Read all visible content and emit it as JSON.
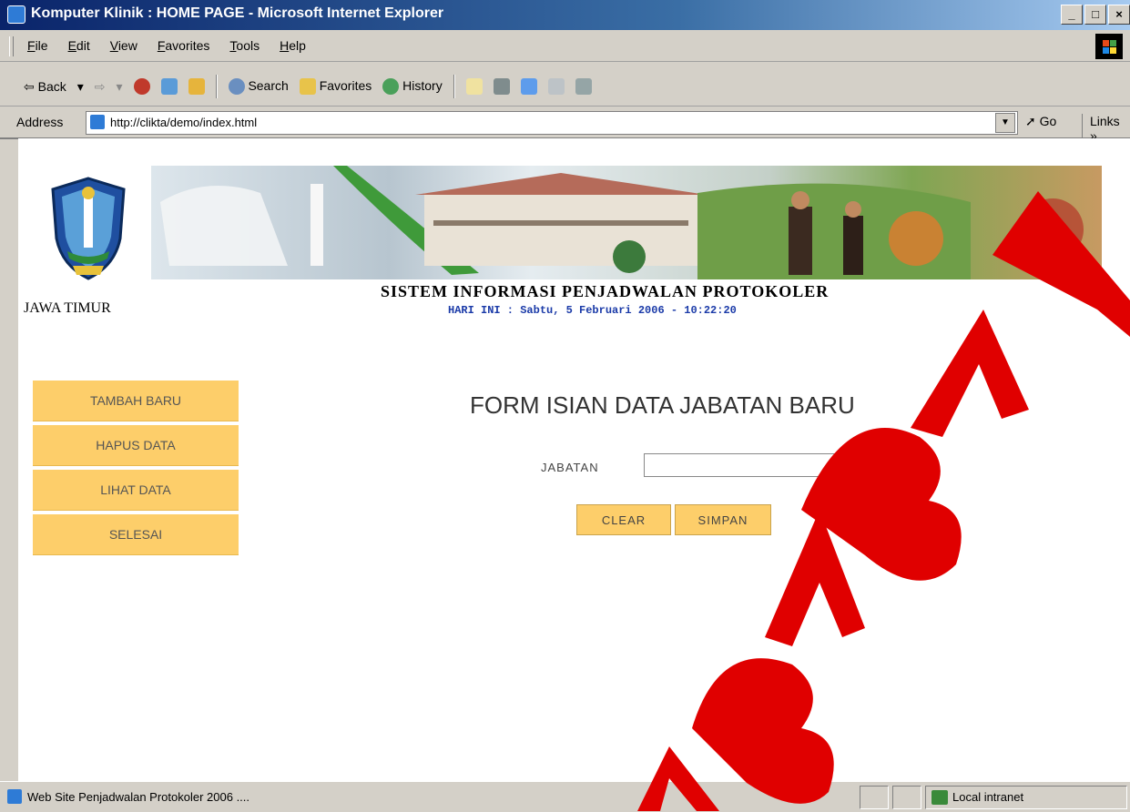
{
  "window": {
    "title": "Komputer Klinik : HOME PAGE - Microsoft Internet Explorer",
    "min_glyph": "_",
    "max_glyph": "□",
    "close_glyph": "×"
  },
  "menu": [
    "File",
    "Edit",
    "View",
    "Favorites",
    "Tools",
    "Help"
  ],
  "toolbar": {
    "back": "⇦ Back",
    "back_drop": "▾",
    "forward": "⇨",
    "forward_drop": "▾",
    "search": "Search",
    "favorites": "Favorites",
    "history": "History"
  },
  "address": {
    "label": "Address",
    "url": "http://clikta/demo/index.html",
    "go": "Go",
    "links": "Links",
    "links_arrow": "»"
  },
  "page": {
    "logo_caption": "JAWA TIMUR",
    "system_title": "SISTEM INFORMASI PENJADWALAN PROTOKOLER",
    "date_line": "HARI INI : Sabtu, 5 Februari 2006 - 10:22:20",
    "sidebar": [
      "TAMBAH BARU",
      "HAPUS DATA",
      "LIHAT DATA",
      "SELESAI"
    ],
    "form_title": "FORM ISIAN DATA JABATAN BARU",
    "field_label": "JABATAN",
    "field_value": "",
    "required_mark": "*",
    "btn_clear": "CLEAR",
    "btn_simpan": "SIMPAN"
  },
  "status": {
    "text": "Web Site Penjadwalan Protokoler 2006 ....",
    "zone": "Local intranet"
  },
  "colors": {
    "sidebar_button": "#fdce6a",
    "watermark": "#e00000",
    "date_text": "#1a3aa8"
  }
}
